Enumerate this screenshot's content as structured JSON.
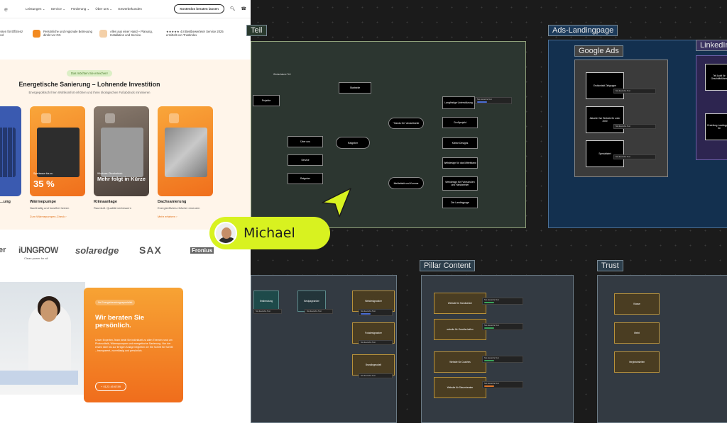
{
  "site": {
    "logo": "e",
    "menu": [
      "Leistungen ⌄",
      "Service ⌄",
      "Förderung ⌄",
      "Über uns ⌄",
      "Gewerbekunden"
    ],
    "cta": "Kostenlos beraten lassen",
    "benefits": [
      {
        "text": "essen für Effizienz und"
      },
      {
        "text": "Persönliche und regionale Betreuung direkt vor Ort."
      },
      {
        "text": "Alles aus einer Hand – Planung, Installation und Service."
      },
      {
        "text": "★★★★★ 4.8 Bestbewerteter Service 2025 ermittelt von Trustindex"
      }
    ],
    "hero": {
      "pill": "Das möchten Sie erreichen!",
      "title": "Energetische Sanierung – Lohnende Investition",
      "subtitle": "Energiepolitisch Ihren Wohlkomfort erhöhen und Ihren ökologischen Fußabdruck minimieren",
      "cards": [
        {
          "title": "...ung",
          "desc": "...",
          "link": ""
        },
        {
          "small": "Sparkasse bis zu",
          "big": "35 %",
          "title": "Wärmepumpe",
          "desc": "Nachhaltig und fossilfrei heizen",
          "link": "Zum Wärmepumpen-Check ›"
        },
        {
          "small": "Windows Ohnebetrieb",
          "big": "Mehr folgt in Kürze",
          "title": "Klimaanlage",
          "desc": "Raumluft. Qualität verbessern",
          "link": ""
        },
        {
          "small": "",
          "big": "",
          "title": "Dachsanierung",
          "desc": "Energieeffizienz Dächer erneuern",
          "link": "Mehr erfahren ›"
        }
      ]
    },
    "brands": [
      "er",
      "iUNGROW",
      "solaredge",
      "SAX",
      "Fronius"
    ],
    "brand_tag": "Clean power for all",
    "advice": {
      "pill": "Ihr Energieberatungsspezialist",
      "title": "Wir beraten Sie persönlich.",
      "body": "Unser Experten-Team berät Sie individuell zu allen Themen rund um Photovoltaik, Wärmepumpen und energetische Sanierung. Von der ersten Idee bis zur fertigen Anlage begleiten wir Sie Schritt für Schritt – transparent, zuverlässig und persönlich.",
      "button": "+ 0123 45 6789"
    }
  },
  "board": {
    "frames": {
      "teil": "Teil",
      "ads": "Ads-Landingpage",
      "google": "Google Ads",
      "linkedin": "LinkedIn",
      "pillar": "Pillar Content",
      "trust": "Trust"
    },
    "mindmap": {
      "caption": "Wortschatzer Teil",
      "projekt": "Projekte",
      "startseite": "Startseite",
      "ueber": "Über uns",
      "service": "Service",
      "ratgeber": "Ratgeber",
      "hub": "Ratgeber",
      "hands_on": "\"Hands On\" Ansichtseite",
      "meldung": "Meldeblatt und Komme",
      "langfristig": "Langfristige Unterstützung",
      "grossprojekt": "Großprojekt",
      "kleine": "Kleine Designs",
      "r1": "Webdesign für das Mittelstand",
      "r2": "Webdesign für Fahrschulen und Handwerker",
      "r3": "Die Landingpage"
    },
    "google_nodes": [
      "Erstkontakt Zielgruppe",
      "Aktuelle Ihre Website für unter 2000",
      "Spezialisiert"
    ],
    "linkedin_nodes": [
      "Tell Audit für Geschäftsführer",
      "Erstellung Landingpage für"
    ],
    "bottom_left": [
      "Erstberatung",
      "Bestpageanker",
      "Webdesignanker",
      "Fotodesignanker",
      "Brandingmodell"
    ],
    "pillar_nodes": [
      "Website für Handwerker",
      "website für Gesellschaften",
      "Website für Coaches",
      "Website für Steuerberater"
    ],
    "trust_nodes": [
      "Klasse",
      "Weibl",
      "Vergleichsleiten"
    ],
    "notes": "Not deutsche Text"
  },
  "cursor": {
    "user": "Michael",
    "color": "#d8f220"
  }
}
